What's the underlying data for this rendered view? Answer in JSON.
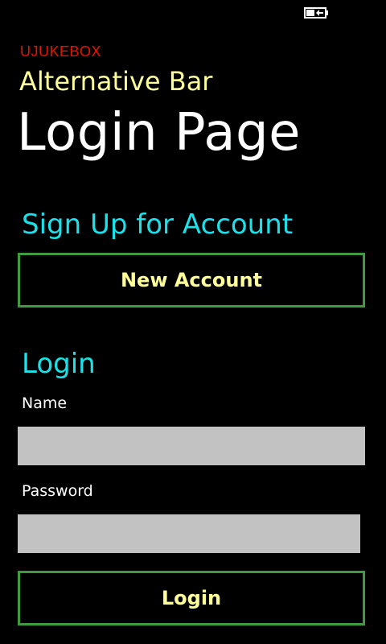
{
  "colors": {
    "background": "#000000",
    "app_name": "#e51400",
    "subtitle": "#ffff99",
    "title": "#ffffff",
    "section_heading": "#1be1e8",
    "button_border": "#3e9c3e",
    "button_text": "#ffff99",
    "input_fill": "#c2c2c2",
    "label": "#ffffff"
  },
  "status_bar": {
    "icon": "battery-charging-icon"
  },
  "header": {
    "app_name": "UJUKEBOX",
    "subtitle": "Alternative Bar",
    "title": "Login Page"
  },
  "signup": {
    "heading": "Sign Up for Account",
    "button_label": "New Account"
  },
  "login": {
    "heading": "Login",
    "name_label": "Name",
    "name_value": "",
    "password_label": "Password",
    "password_value": "",
    "button_label": "Login"
  }
}
